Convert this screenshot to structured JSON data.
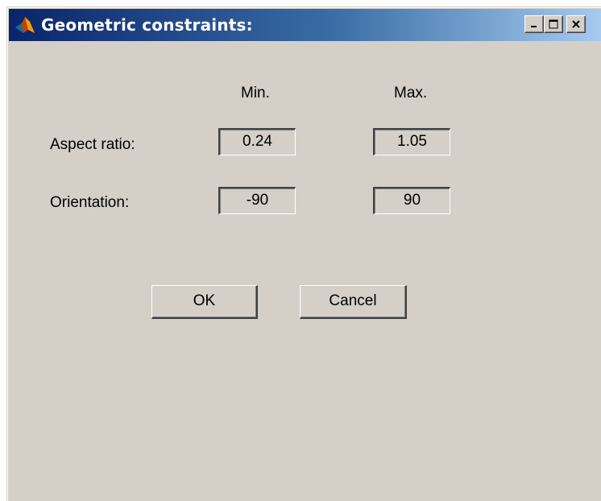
{
  "window": {
    "title": "Geometric constraints:",
    "app_icon": "matlab-logo-icon",
    "controls": [
      "minimize-icon",
      "maximize-icon",
      "close-icon"
    ]
  },
  "columns": {
    "min_label": "Min.",
    "max_label": "Max."
  },
  "rows": [
    {
      "label": "Aspect ratio:",
      "min_value": "0.24",
      "max_value": "1.05"
    },
    {
      "label": "Orientation:",
      "min_value": "-90",
      "max_value": "90"
    }
  ],
  "buttons": {
    "ok_label": "OK",
    "cancel_label": "Cancel"
  }
}
